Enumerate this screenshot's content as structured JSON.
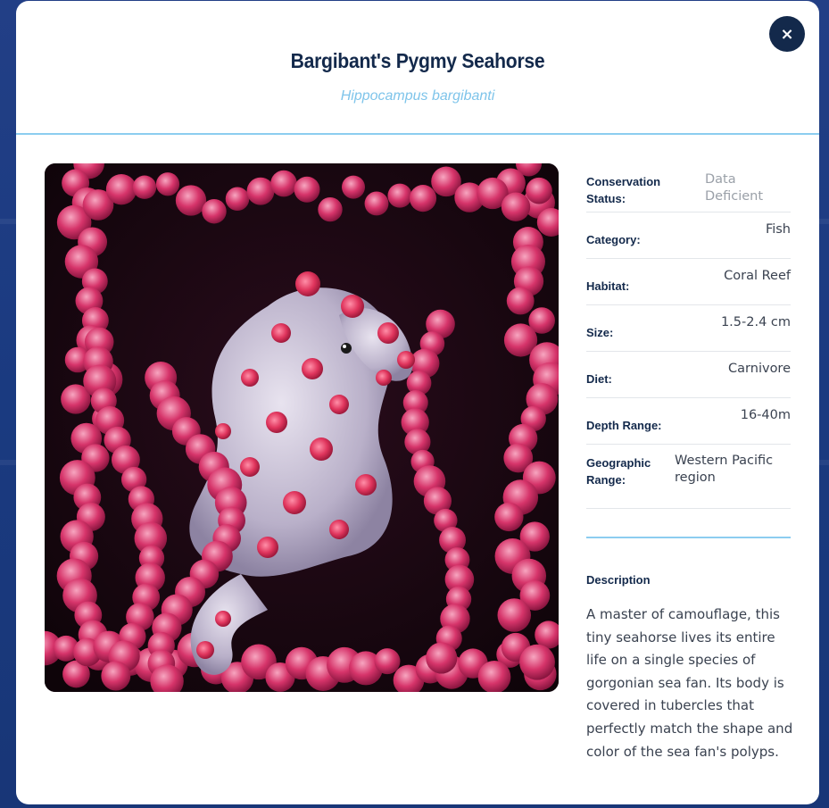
{
  "modal": {
    "title": "Bargibant's Pygmy Seahorse",
    "scientific_name": "Hippocampus bargibanti",
    "close_label": "×"
  },
  "details": [
    {
      "label": "Conservation Status:",
      "value": "Data Deficient",
      "style": "muted"
    },
    {
      "label": "Category:",
      "value": "Fish",
      "style": "right"
    },
    {
      "label": "Habitat:",
      "value": "Coral Reef",
      "style": "right"
    },
    {
      "label": "Size:",
      "value": "1.5-2.4 cm",
      "style": "right"
    },
    {
      "label": "Diet:",
      "value": "Carnivore",
      "style": "right"
    },
    {
      "label": "Depth Range:",
      "value": "16-40m",
      "style": "right"
    },
    {
      "label": "Geographic Range:",
      "value": "Western Pacific region",
      "style": "left"
    }
  ],
  "description": {
    "heading": "Description",
    "text": "A master of camouflage, this tiny seahorse lives its entire life on a single species of gorgonian sea fan. Its body is covered in tubercles that perfectly match the shape and color of the sea fan's polyps."
  },
  "colors": {
    "title": "#13294b",
    "accent": "#8ccdf0",
    "subtitle": "#7ec4ea",
    "close_bg": "#13294b"
  }
}
